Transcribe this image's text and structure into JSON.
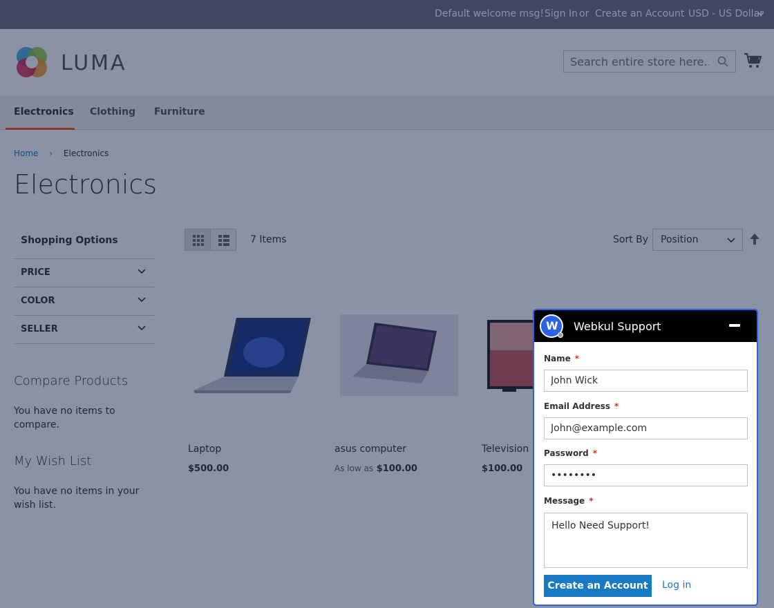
{
  "topbar": {
    "welcome": "Default welcome msg!",
    "sign_in": "Sign In",
    "or": "or",
    "create_account": "Create an Account",
    "currency": "USD - US Dollar"
  },
  "header": {
    "logo_text": "LUMA",
    "search_placeholder": "Search entire store here..."
  },
  "nav": {
    "items": [
      "Electronics",
      "Clothing",
      "Furniture"
    ],
    "active": "Electronics"
  },
  "breadcrumb": {
    "home": "Home",
    "current": "Electronics"
  },
  "page_title": "Electronics",
  "sidebar": {
    "title": "Shopping Options",
    "filters": [
      "PRICE",
      "COLOR",
      "SELLER"
    ],
    "compare_title": "Compare Products",
    "compare_text": "You have no items to compare.",
    "wishlist_title": "My Wish List",
    "wishlist_text": "You have no items in your wish list."
  },
  "toolbar": {
    "items_count": "7 Items",
    "sort_label": "Sort By",
    "sort_value": "Position"
  },
  "products": [
    {
      "name": "Laptop",
      "price_prefix": "",
      "price": "$500.00"
    },
    {
      "name": "asus computer",
      "price_prefix": "As low as",
      "price": "$100.00"
    },
    {
      "name": "Television",
      "price_prefix": "",
      "price": "$100.00"
    }
  ],
  "chat": {
    "title": "Webkul Support",
    "avatar_letter": "W",
    "name_label": "Name",
    "name_value": "John Wick",
    "email_label": "Email Address",
    "email_value": "John@example.com",
    "password_label": "Password",
    "password_value": "password",
    "message_label": "Message",
    "message_value": "Hello Need Support!",
    "submit_label": "Create an Account",
    "login_label": "Log in",
    "required_mark": "*"
  },
  "colors": {
    "link": "#1979c3",
    "accent": "#ff5501",
    "chat_border": "#2a5ff0",
    "overlay": "rgba(12, 28, 66, 0.48)"
  }
}
